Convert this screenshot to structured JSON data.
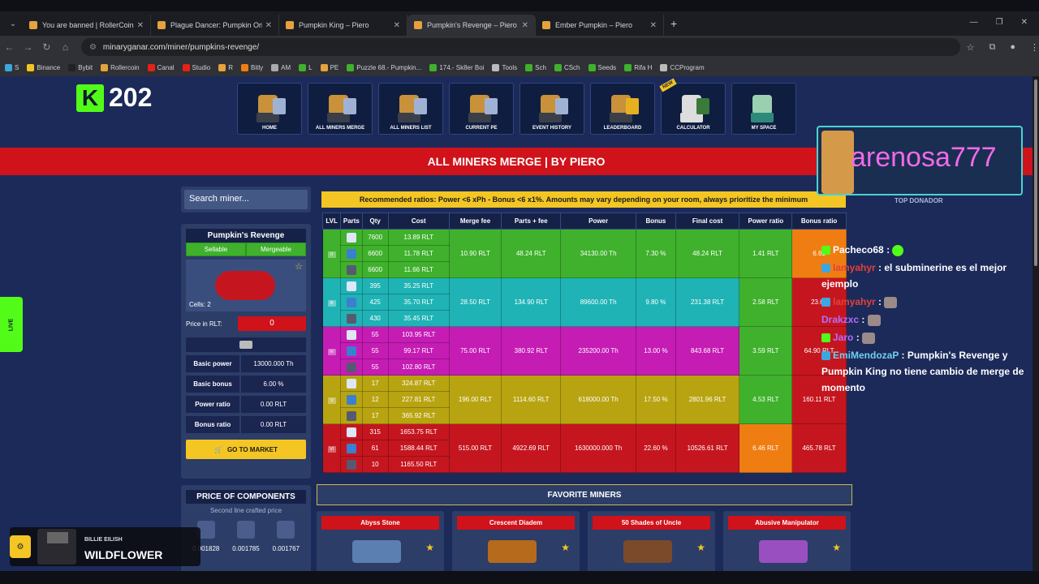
{
  "browser": {
    "tabs": [
      {
        "label": "You are banned | RollerCoin.com",
        "active": false
      },
      {
        "label": "Plague Dancer: Pumpkin Origin",
        "active": false
      },
      {
        "label": "Pumpkin King – Piero",
        "active": false
      },
      {
        "label": "Pumpkin's Revenge – Piero",
        "active": true
      },
      {
        "label": "Ember Pumpkin – Piero",
        "active": false
      }
    ],
    "url": "minaryganar.com/miner/pumpkins-revenge/",
    "bookmarks": [
      "S",
      "Binance",
      "Bybit",
      "Rollercoin",
      "Canal",
      "Studio",
      "R",
      "Bitly",
      "AM",
      "L",
      "PE",
      "Puzzle 68.- Pumpkin...",
      "174.- Sk8er Boi",
      "Tools",
      "Sch",
      "CSch",
      "Seeds",
      "Rifa H",
      "CCProgram"
    ]
  },
  "header": {
    "kick_count": "202",
    "nav": [
      {
        "label": "HOME",
        "new": false
      },
      {
        "label": "ALL MINERS MERGE",
        "new": false
      },
      {
        "label": "ALL MINERS LIST",
        "new": false
      },
      {
        "label": "CURRENT PE",
        "new": false
      },
      {
        "label": "EVENT HISTORY",
        "new": false
      },
      {
        "label": "LEADERBOARD",
        "new": false
      },
      {
        "label": "CALCULATOR",
        "new": true
      },
      {
        "label": "MY SPACE",
        "new": false
      }
    ],
    "new_badge": "NEW",
    "banner_title": "ALL MINERS MERGE | BY PIERO"
  },
  "donor": {
    "name": "arenosa777",
    "tag": "TOP DONADOR"
  },
  "sidebar": {
    "search_placeholder": "Search miner...",
    "miner": {
      "title": "Pumpkin's Revenge",
      "tag1": "Sellable",
      "tag2": "Mergeable",
      "cells": "Cells: 2",
      "price_label": "Price in RLT:",
      "price_value": "0",
      "stats": [
        {
          "label": "Basic power",
          "value": "13000.000 Th"
        },
        {
          "label": "Basic bonus",
          "value": "6.00 %"
        },
        {
          "label": "Power ratio",
          "value": "0.00 RLT"
        },
        {
          "label": "Bonus ratio",
          "value": "0.00 RLT"
        }
      ],
      "market_button": "GO TO MARKET"
    },
    "components": {
      "title": "PRICE OF COMPONENTS",
      "subtitle": "Second line crafted price",
      "values": [
        "0.001828",
        "0.001785",
        "0.001767"
      ]
    }
  },
  "main": {
    "recommendation": "Recommended ratios: Power <6 xPh - Bonus <6 x1%. Amounts may vary depending on your room, always prioritize the minimum",
    "columns": [
      "LVL",
      "Parts",
      "Qty",
      "Cost",
      "Merge fee",
      "Parts + fee",
      "Power",
      "Bonus",
      "Final cost",
      "Power ratio",
      "Bonus ratio"
    ],
    "levels": [
      {
        "lvl": "II",
        "color": "#3fb12c",
        "merge_fee": "10.90 RLT",
        "parts_fee": "48.24 RLT",
        "power": "34130.00 Th",
        "bonus": "7.30 %",
        "final_cost": "48.24 RLT",
        "power_ratio": "1.41 RLT",
        "power_ratio_color": "#3fb12c",
        "bonus_ratio": "6.61",
        "bonus_ratio_color": "#f07d12",
        "parts": [
          {
            "qty": "7600",
            "cost": "13.89 RLT"
          },
          {
            "qty": "6600",
            "cost": "11.78 RLT"
          },
          {
            "qty": "6600",
            "cost": "11.66 RLT"
          }
        ]
      },
      {
        "lvl": "III",
        "color": "#1fb3b5",
        "merge_fee": "28.50 RLT",
        "parts_fee": "134.90 RLT",
        "power": "89600.00 Th",
        "bonus": "9.80 %",
        "final_cost": "231.38 RLT",
        "power_ratio": "2.58 RLT",
        "power_ratio_color": "#3fb12c",
        "bonus_ratio": "23.61",
        "bonus_ratio_color": "#c5161f",
        "parts": [
          {
            "qty": "395",
            "cost": "35.25 RLT"
          },
          {
            "qty": "425",
            "cost": "35.70 RLT"
          },
          {
            "qty": "430",
            "cost": "35.45 RLT"
          }
        ]
      },
      {
        "lvl": "IV",
        "color": "#c51cb4",
        "merge_fee": "75.00 RLT",
        "parts_fee": "380.92 RLT",
        "power": "235200.00 Th",
        "bonus": "13.00 %",
        "final_cost": "843.68 RLT",
        "power_ratio": "3.59 RLT",
        "power_ratio_color": "#3fb12c",
        "bonus_ratio": "64.90 RLT",
        "bonus_ratio_color": "#c5161f",
        "parts": [
          {
            "qty": "55",
            "cost": "103.95 RLT"
          },
          {
            "qty": "55",
            "cost": "99.17 RLT"
          },
          {
            "qty": "55",
            "cost": "102.80 RLT"
          }
        ]
      },
      {
        "lvl": "V",
        "color": "#b8a411",
        "merge_fee": "196.00 RLT",
        "parts_fee": "1114.60 RLT",
        "power": "618000.00 Th",
        "bonus": "17.50 %",
        "final_cost": "2801.96 RLT",
        "power_ratio": "4.53 RLT",
        "power_ratio_color": "#3fb12c",
        "bonus_ratio": "160.11 RLT",
        "bonus_ratio_color": "#c5161f",
        "parts": [
          {
            "qty": "17",
            "cost": "324.87 RLT"
          },
          {
            "qty": "12",
            "cost": "227.81 RLT"
          },
          {
            "qty": "17",
            "cost": "365.92 RLT"
          }
        ]
      },
      {
        "lvl": "VI",
        "color": "#c5161f",
        "merge_fee": "515.00 RLT",
        "parts_fee": "4922.69 RLT",
        "power": "1630000.000 Th",
        "bonus": "22.60 %",
        "final_cost": "10526.61 RLT",
        "power_ratio": "6.46 RLT",
        "power_ratio_color": "#f07d12",
        "bonus_ratio": "465.78 RLT",
        "bonus_ratio_color": "#c5161f",
        "parts": [
          {
            "qty": "315",
            "cost": "1653.75 RLT"
          },
          {
            "qty": "61",
            "cost": "1588.44 RLT"
          },
          {
            "qty": "10",
            "cost": "1165.50 RLT"
          }
        ]
      }
    ],
    "favorites_title": "FAVORITE MINERS",
    "favorites": [
      {
        "name": "Abyss Stone",
        "color": "#5b7fb0"
      },
      {
        "name": "Crescent Diadem",
        "color": "#b56a1c"
      },
      {
        "name": "50 Shades of Uncle",
        "color": "#7a4a2a"
      },
      {
        "name": "Abusive Manipulator",
        "color": "#9a4fc0"
      }
    ]
  },
  "overlay": {
    "live": "LIVE",
    "chat": [
      {
        "user": "Pacheco68",
        "text": ""
      },
      {
        "user": "lamyahyr",
        "text": ": el subminerine es el mejor ejemplo"
      },
      {
        "user": "lamyahyr",
        "text": ""
      },
      {
        "user": "Drakzxc",
        "text": ""
      },
      {
        "user": "Jaro",
        "text": ""
      },
      {
        "user": "EmiMendozaP",
        "text": ": Pumpkin's Revenge y Pumpkin King no tiene cambio de merge de momento"
      }
    ],
    "music": {
      "artist": "BILLIE EILISH",
      "song": "WILDFLOWER"
    }
  }
}
